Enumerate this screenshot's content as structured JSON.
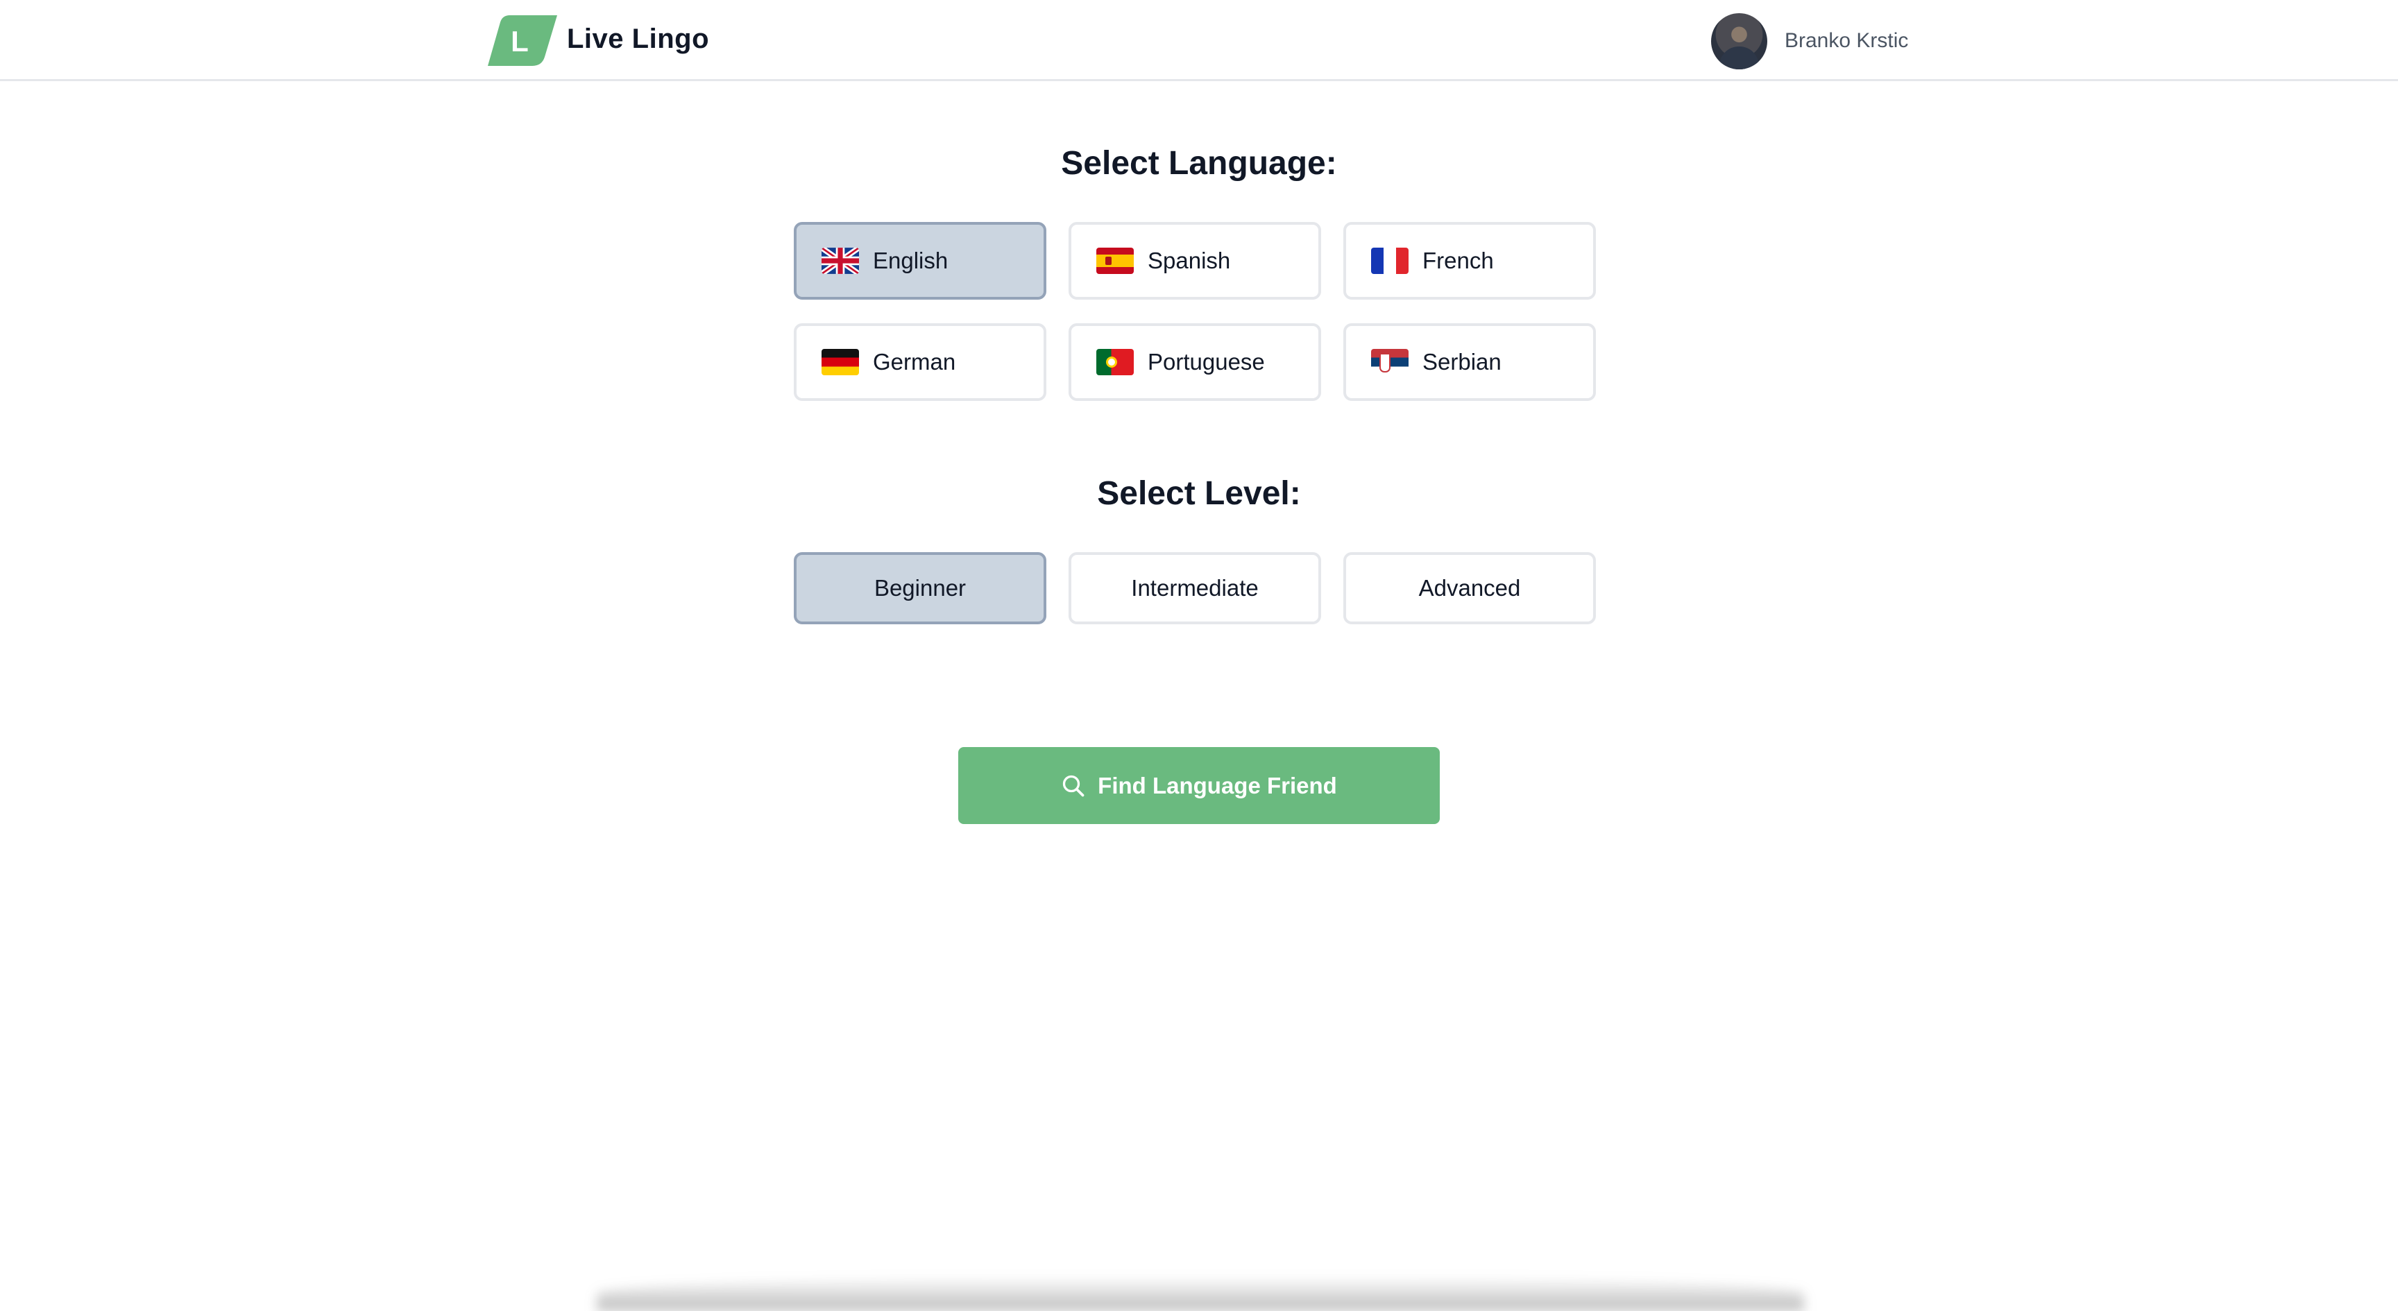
{
  "header": {
    "logo_letter": "L",
    "brand_name": "Live Lingo",
    "user_name": "Branko Krstic"
  },
  "language_section": {
    "title": "Select Language:",
    "options": [
      {
        "label": "English",
        "flag": "uk-flag-icon",
        "selected": true
      },
      {
        "label": "Spanish",
        "flag": "spain-flag-icon",
        "selected": false
      },
      {
        "label": "French",
        "flag": "france-flag-icon",
        "selected": false
      },
      {
        "label": "German",
        "flag": "germany-flag-icon",
        "selected": false
      },
      {
        "label": "Portuguese",
        "flag": "portugal-flag-icon",
        "selected": false
      },
      {
        "label": "Serbian",
        "flag": "serbia-flag-icon",
        "selected": false
      }
    ]
  },
  "level_section": {
    "title": "Select Level:",
    "options": [
      {
        "label": "Beginner",
        "selected": true
      },
      {
        "label": "Intermediate",
        "selected": false
      },
      {
        "label": "Advanced",
        "selected": false
      }
    ]
  },
  "action": {
    "find_label": "Find Language Friend",
    "icon": "search-icon"
  },
  "colors": {
    "accent": "#6aba7f",
    "selected_bg": "#cbd5e0",
    "border": "#e5e7eb"
  }
}
